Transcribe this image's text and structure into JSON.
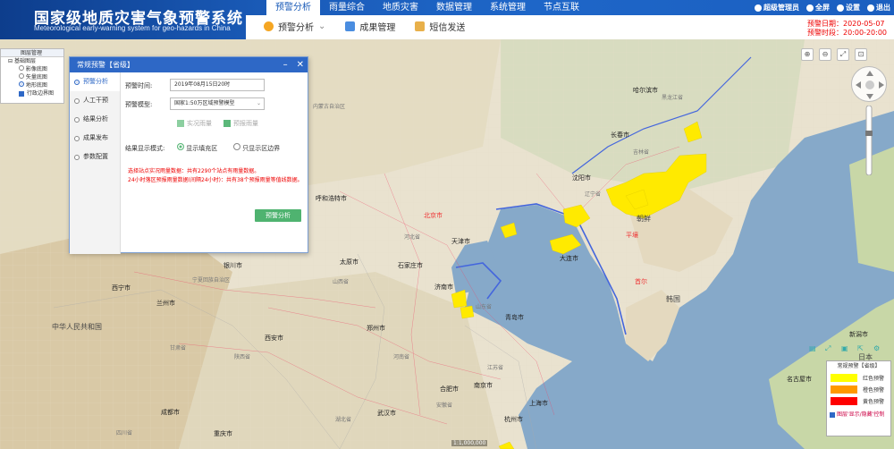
{
  "header": {
    "title": "国家级地质灾害气象预警系统",
    "subtitle": "Meteorological early-warning system for geo-hazards in China",
    "nav": [
      "预警分析",
      "雨量综合",
      "地质灾害",
      "数据管理",
      "系统管理",
      "节点互联"
    ],
    "user": {
      "name": "超级管理员",
      "fullscreen": "全屏",
      "settings": "设置",
      "logout": "退出"
    }
  },
  "subnav": [
    "预警分析",
    "成果管理",
    "短信发送"
  ],
  "warning_info": {
    "date_label": "预警日期：",
    "date": "2020-05-07",
    "time_label": "预警时段：",
    "time": "20:00-20:00"
  },
  "layer_panel": {
    "title": "图层管理",
    "group": "基础图层",
    "items": [
      "影像底图",
      "矢量底图",
      "地形底图",
      "行政边界图"
    ]
  },
  "dialog": {
    "title": "常规预警【省级】",
    "side": [
      "预警分析",
      "人工干预",
      "结果分析",
      "成果发布",
      "参数配置"
    ],
    "time_label": "预警时间:",
    "time_value": "2019年08月15日20时",
    "model_label": "预警模型:",
    "model_value": "国家1:50万区域预警模型",
    "cb1": "实况雨量",
    "cb2": "预报雨量",
    "mode_label": "结果显示模式:",
    "mode_opt1": "显示填充区",
    "mode_opt2": "只显示区边界",
    "msg1": "选择站点实况雨量数据：共有2290个站点有雨量数据。",
    "msg2": "24小时落区预报雨量数据(间隔24小时)：共有38个预报雨量等值线数据。",
    "button": "预警分析"
  },
  "legend": {
    "title": "常规预警【省级】",
    "items": [
      {
        "label": "红色预警",
        "color": "#ffff00"
      },
      {
        "label": "橙色预警",
        "color": "#ff9900"
      },
      {
        "label": "黄色预警",
        "color": "#ff0000"
      }
    ],
    "footer": "图层'显示/隐藏'控制"
  },
  "coord": "1:1,000,000",
  "map_labels": [
    {
      "text": "哈尔滨市",
      "cls": "city"
    },
    {
      "text": "长春市",
      "cls": "city"
    },
    {
      "text": "吉林省",
      "cls": "prov"
    },
    {
      "text": "黑龙江省",
      "cls": "prov"
    },
    {
      "text": "沈阳市",
      "cls": "city"
    },
    {
      "text": "辽宁省",
      "cls": "prov"
    },
    {
      "text": "朝鲜",
      "cls": "big"
    },
    {
      "text": "平壤",
      "cls": "red"
    },
    {
      "text": "首尔",
      "cls": "red"
    },
    {
      "text": "韩国",
      "cls": "big"
    },
    {
      "text": "北京市",
      "cls": "red"
    },
    {
      "text": "天津市",
      "cls": "city"
    },
    {
      "text": "呼和浩特市",
      "cls": "city"
    },
    {
      "text": "石家庄市",
      "cls": "city"
    },
    {
      "text": "太原市",
      "cls": "city"
    },
    {
      "text": "济南市",
      "cls": "city"
    },
    {
      "text": "山东省",
      "cls": "prov"
    },
    {
      "text": "河北省",
      "cls": "prov"
    },
    {
      "text": "山西省",
      "cls": "prov"
    },
    {
      "text": "郑州市",
      "cls": "city"
    },
    {
      "text": "河南省",
      "cls": "prov"
    },
    {
      "text": "西安市",
      "cls": "city"
    },
    {
      "text": "陕西省",
      "cls": "prov"
    },
    {
      "text": "银川市",
      "cls": "city"
    },
    {
      "text": "宁夏回族自治区",
      "cls": "prov"
    },
    {
      "text": "兰州市",
      "cls": "city"
    },
    {
      "text": "西宁市",
      "cls": "city"
    },
    {
      "text": "中华人民共和国",
      "cls": "big"
    },
    {
      "text": "甘肃省",
      "cls": "prov"
    },
    {
      "text": "江苏省",
      "cls": "prov"
    },
    {
      "text": "南京市",
      "cls": "city"
    },
    {
      "text": "合肥市",
      "cls": "city"
    },
    {
      "text": "安徽省",
      "cls": "prov"
    },
    {
      "text": "武汉市",
      "cls": "city"
    },
    {
      "text": "湖北省",
      "cls": "prov"
    },
    {
      "text": "杭州市",
      "cls": "city"
    },
    {
      "text": "上海市",
      "cls": "city"
    },
    {
      "text": "成都市",
      "cls": "city"
    },
    {
      "text": "重庆市",
      "cls": "city"
    },
    {
      "text": "四川省",
      "cls": "prov"
    },
    {
      "text": "内蒙古自治区",
      "cls": "prov"
    },
    {
      "text": "青岛市",
      "cls": "city"
    },
    {
      "text": "大连市",
      "cls": "city"
    },
    {
      "text": "新潟市",
      "cls": "city"
    },
    {
      "text": "名古屋市",
      "cls": "city"
    },
    {
      "text": "日本",
      "cls": "big"
    }
  ]
}
